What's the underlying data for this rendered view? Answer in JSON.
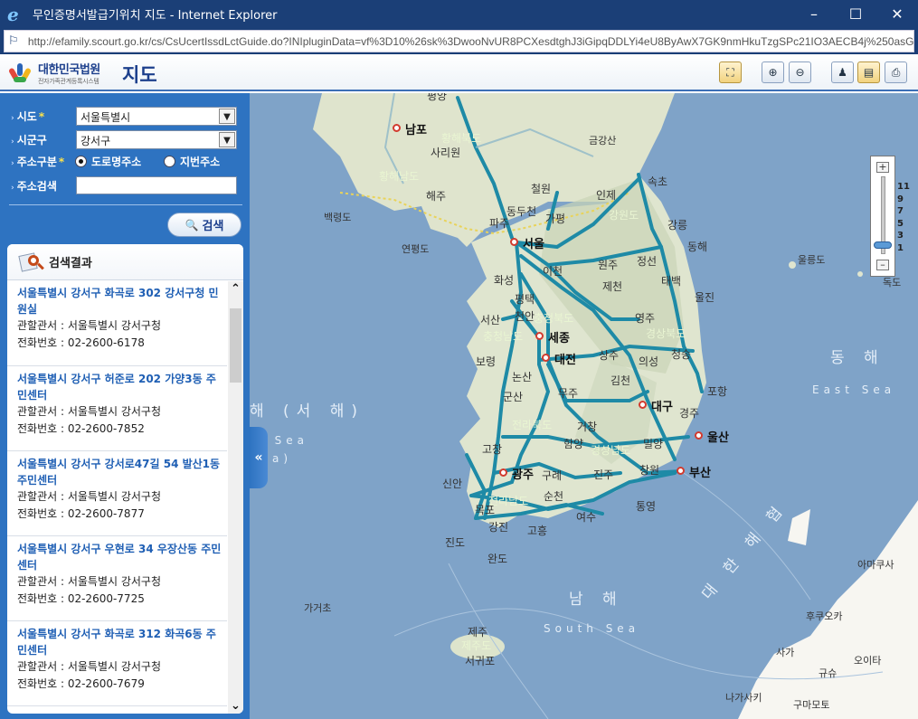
{
  "window": {
    "title": "무인증명서발급기위치 지도 - Internet Explorer",
    "url": "http://efamily.scourt.go.kr/cs/CsUcertIssdLctGuide.do?INIpluginData=vf%3D10%26sk%3DwooNvUR8PCXesdtghJ3iGipqDDLYi4eU8ByAwX7GK9nmHkuTzgSPc21IO3AECB4j%250asGW"
  },
  "header": {
    "court_name": "대한민국법원",
    "court_sub": "전자가족관계등록시스템",
    "page_title": "지도",
    "tools": [
      "map-info-icon",
      "zoom-in-icon",
      "zoom-out-icon",
      "map-tool-icon",
      "ruler-icon",
      "print-icon"
    ]
  },
  "form": {
    "sido_label": "시도",
    "sido_value": "서울특별시",
    "sigungu_label": "시군구",
    "sigungu_value": "강서구",
    "addr_type_label": "주소구분",
    "addr_type_option1": "도로명주소",
    "addr_type_option2": "지번주소",
    "addr_type_selected": "도로명주소",
    "addr_search_label": "주소검색",
    "addr_search_value": "",
    "search_button": "검색",
    "required_mark": "*"
  },
  "results": {
    "title": "검색결과",
    "items": [
      {
        "name": "서울특별시 강서구 화곡로 302 강서구청 민원실",
        "office": "관할관서 : 서울특별시 강서구청",
        "phone": "전화번호 : 02-2600-6178"
      },
      {
        "name": "서울특별시 강서구 허준로 202 가양3동 주민센터",
        "office": "관할관서 : 서울특별시 강서구청",
        "phone": "전화번호 : 02-2600-7852"
      },
      {
        "name": "서울특별시 강서구 강서로47길 54 발산1동 주민센터",
        "office": "관할관서 : 서울특별시 강서구청",
        "phone": "전화번호 : 02-2600-7877"
      },
      {
        "name": "서울특별시 강서구 우현로 34 우장산동 주민센터",
        "office": "관할관서 : 서울특별시 강서구청",
        "phone": "전화번호 : 02-2600-7725"
      },
      {
        "name": "서울특별시 강서구 화곡로 312 화곡6동 주민센터",
        "office": "관할관서 : 서울특별시 강서구청",
        "phone": "전화번호 : 02-2600-7679"
      }
    ]
  },
  "map": {
    "zoom_levels": [
      "11",
      "9",
      "7",
      "5",
      "3",
      "1"
    ],
    "current_zoom": "1",
    "labels": {
      "nampo": "남포",
      "sariwon": "사리원",
      "hwanghae_north": "황해북도",
      "hwanghae_south": "황해남도",
      "haeju": "해주",
      "baengnyeong": "백령도",
      "yeonpyeong": "연평도",
      "geumgangsan": "금강산",
      "sokcho": "속초",
      "cheorwon": "철원",
      "inje": "인제",
      "dongducheon": "동두천",
      "paju": "파주",
      "gapyeong": "가평",
      "gangwon": "강원도",
      "gangneung": "강릉",
      "donghae": "동해",
      "seoul": "서울",
      "ulleungdo": "울릉도",
      "dokdo": "독도",
      "icheon": "이천",
      "wonju": "원주",
      "jeongseon": "정선",
      "hwaseong": "화성",
      "pyeongtaek": "평택",
      "jecheon": "제천",
      "taebaek": "태백",
      "uljin": "울진",
      "cheonan": "천안",
      "chungcheong_north": "충청북도",
      "yeongju": "영주",
      "seosan": "서산",
      "chungcheong_south": "충청남도",
      "sejong": "세종",
      "gyeongbuk": "경상북도",
      "sangju": "상주",
      "andong": "안동",
      "cheongsong": "청송",
      "boryeong": "보령",
      "daejeon": "대전",
      "uiseong": "의성",
      "donghae_sea": "동 해",
      "east_sea": "East Sea",
      "nonsan": "논산",
      "gimcheon": "김천",
      "pohang": "포항",
      "gunsan": "군산",
      "muju": "무주",
      "daegu": "대구",
      "gyeongju": "경주",
      "west_sea": "해 (서 해)",
      "yellow_sea": "w Sea",
      "sea_paren": "Sea)",
      "jeonbuk": "전라북도",
      "geochang": "거창",
      "ulsan": "울산",
      "gochang": "고창",
      "hamyang": "함양",
      "miryang": "밀양",
      "gyeongnam": "경상남도",
      "gwangju": "광주",
      "gurye": "구례",
      "jinju": "진주",
      "changwon": "창원",
      "busan": "부산",
      "sinan": "신안",
      "suncheon": "순천",
      "mokpo": "목포",
      "jeonnam": "전라남도",
      "tongyeong": "통영",
      "gangjin": "강진",
      "goheung": "고흥",
      "yeosu": "여수",
      "jindo": "진도",
      "wando": "완도",
      "daehan_strait": "대 한 해 협",
      "amakusa": "아마쿠사",
      "gageodo": "가거초",
      "namhae": "남 해",
      "south_sea": "South Sea",
      "fukuoka": "후쿠오카",
      "jeju": "제주",
      "jeju_do": "제주도",
      "seogwipo": "서귀포",
      "saga": "사가",
      "oita": "오이타",
      "gyusu": "규슈",
      "nagasaki": "나가사키",
      "kumamoto": "구마모토",
      "pyongyang": "평양"
    }
  },
  "colors": {
    "sidebar": "#2e73c1",
    "sea": "#7fa3c8",
    "land": "#dfe5d0",
    "highway": "#1e8aa6",
    "title_blue": "#1c3f8c",
    "link_blue": "#1f5fb4"
  }
}
